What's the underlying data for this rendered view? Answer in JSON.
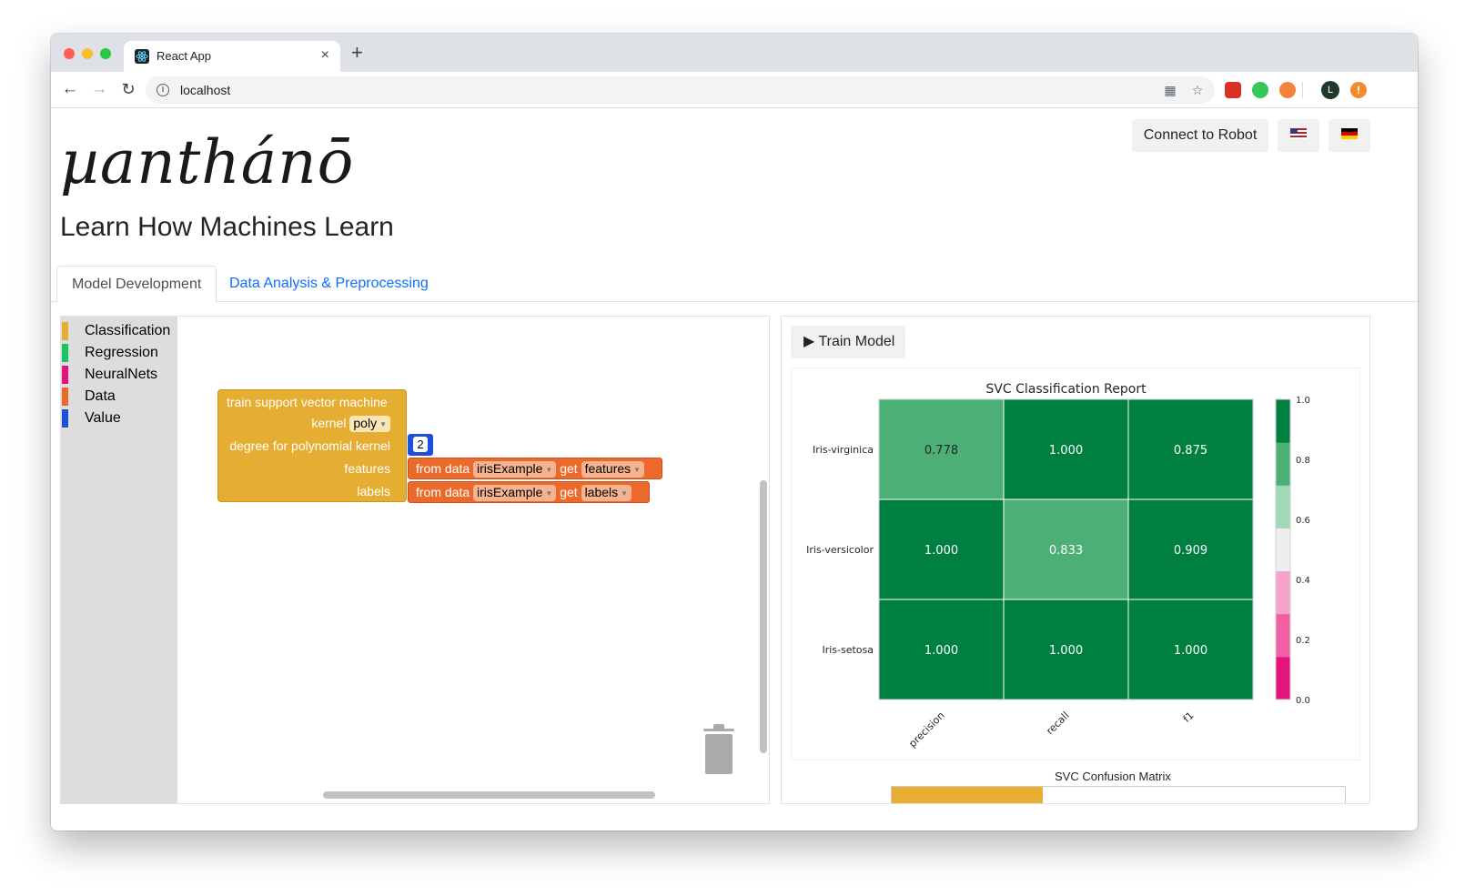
{
  "browser": {
    "tab_title": "React App",
    "tab_close": "×",
    "new_tab": "+",
    "url": "localhost",
    "avatar_letter": "L"
  },
  "header": {
    "logo": "µanthánō",
    "subtitle": "Learn How Machines Learn",
    "connect_label": "Connect to Robot"
  },
  "tabs": [
    {
      "label": "Model Development",
      "active": true
    },
    {
      "label": "Data Analysis & Preprocessing",
      "active": false
    }
  ],
  "toolbox": [
    {
      "label": "Classification",
      "color": "#e5ae32"
    },
    {
      "label": "Regression",
      "color": "#1bc461"
    },
    {
      "label": "NeuralNets",
      "color": "#e3157d"
    },
    {
      "label": "Data",
      "color": "#eb6a2b"
    },
    {
      "label": "Value",
      "color": "#1e4fd8"
    }
  ],
  "blocks": {
    "svm_title": "train support vector machine",
    "kernel_label": "kernel",
    "kernel_value": "poly",
    "degree_label": "degree for polynomial kernel",
    "degree_value": "2",
    "features_label": "features",
    "labels_label": "labels",
    "from_data": "from data",
    "dataset": "irisExample",
    "get": "get",
    "features_value": "features",
    "labels_value": "labels"
  },
  "right": {
    "train_label": "Train Model",
    "confusion_title": "SVC Confusion Matrix"
  },
  "chart_data": {
    "type": "heatmap",
    "title": "SVC Classification Report",
    "rows": [
      "Iris-virginica",
      "Iris-versicolor",
      "Iris-setosa"
    ],
    "columns": [
      "precision",
      "recall",
      "f1"
    ],
    "values": [
      [
        0.778,
        1.0,
        0.875
      ],
      [
        1.0,
        0.833,
        0.909
      ],
      [
        1.0,
        1.0,
        1.0
      ]
    ],
    "value_labels": [
      [
        "0.778",
        "1.000",
        "0.875"
      ],
      [
        "1.000",
        "0.833",
        "0.909"
      ],
      [
        "1.000",
        "1.000",
        "1.000"
      ]
    ],
    "colorbar_range": [
      0.0,
      1.0
    ],
    "colorbar_ticks": [
      "1.0",
      "0.8",
      "0.6",
      "0.4",
      "0.2",
      "0.0"
    ],
    "colorbar_colors": [
      "#e3157d",
      "#f25ea3",
      "#f4a3c9",
      "#eeeeee",
      "#9fd9b5",
      "#4caf76",
      "#008040"
    ],
    "grid": true
  }
}
